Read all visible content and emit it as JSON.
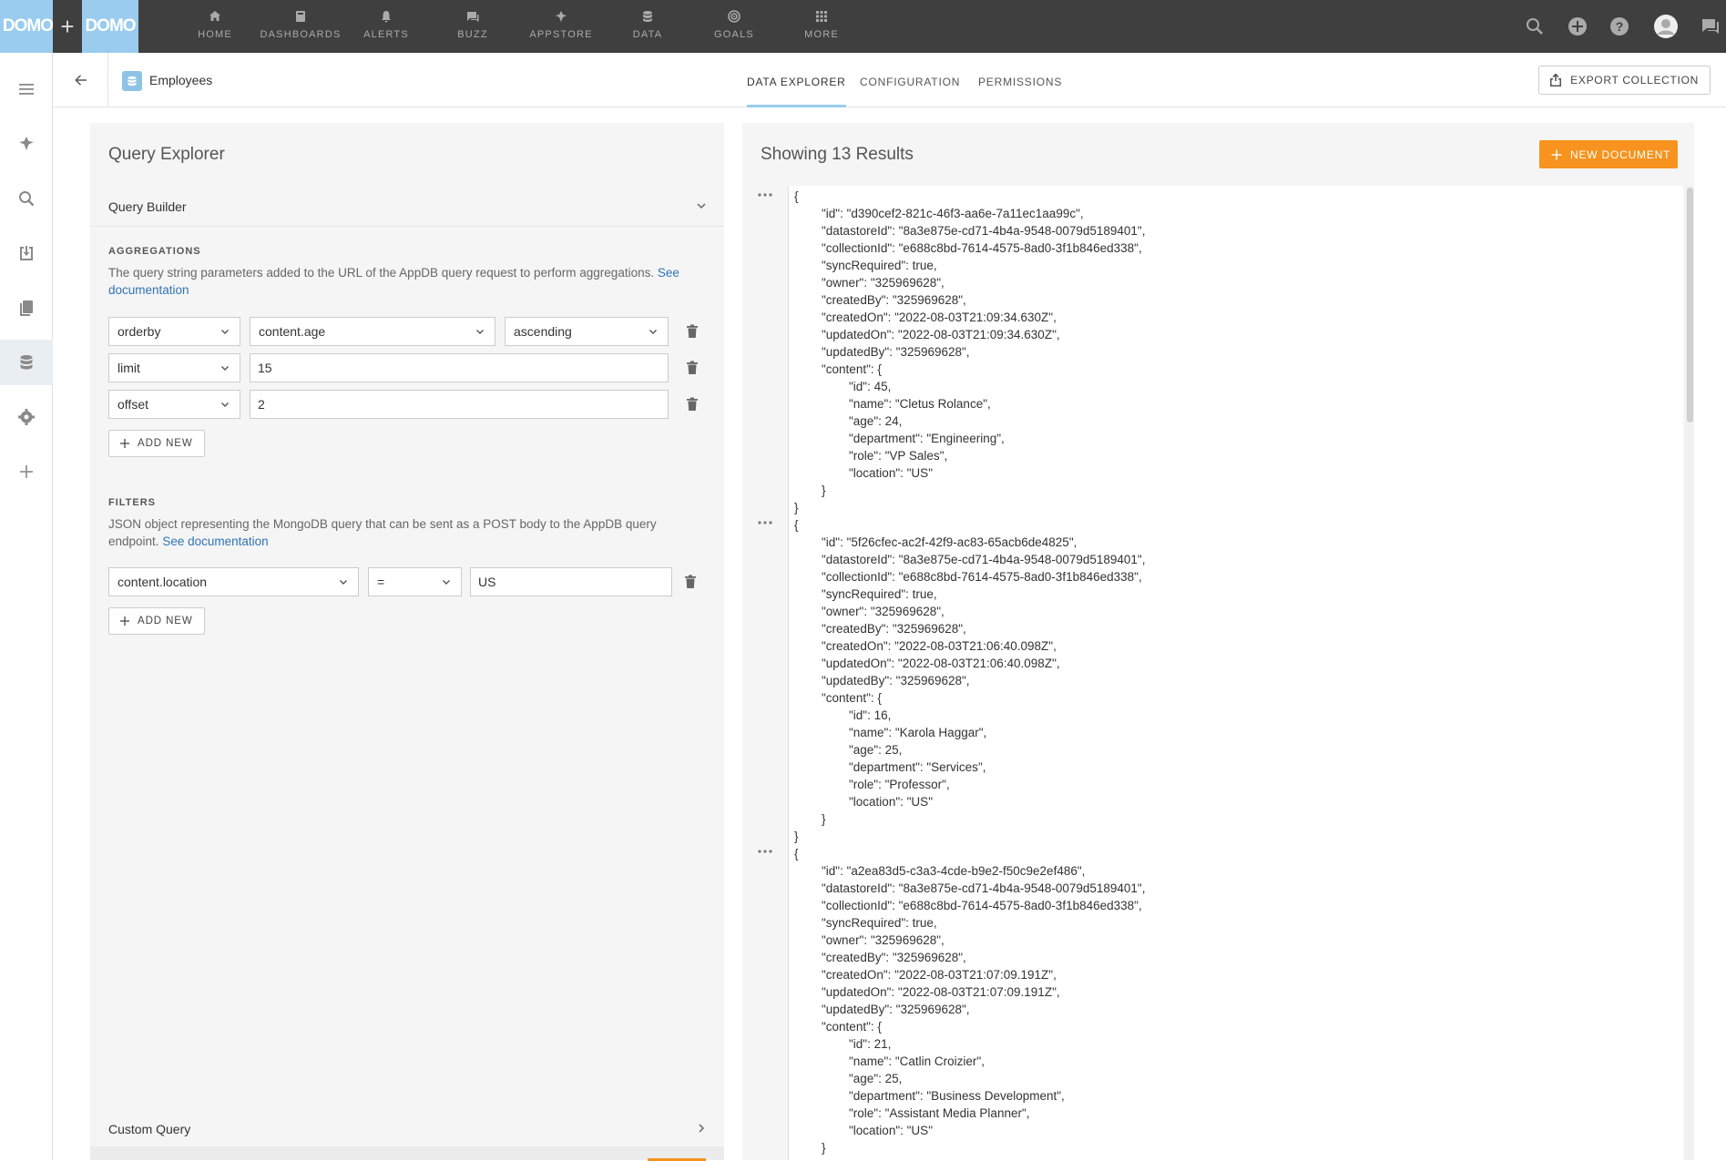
{
  "brand": {
    "logo_left": "DOMO",
    "logo_right": "DOMO",
    "plus": "+"
  },
  "topnav": [
    {
      "label": "HOME",
      "icon": "home-icon"
    },
    {
      "label": "DASHBOARDS",
      "icon": "dashboards-icon"
    },
    {
      "label": "ALERTS",
      "icon": "bell-icon"
    },
    {
      "label": "BUZZ",
      "icon": "chat-icon"
    },
    {
      "label": "APPSTORE",
      "icon": "appstore-icon"
    },
    {
      "label": "DATA",
      "icon": "database-icon"
    },
    {
      "label": "GOALS",
      "icon": "goals-icon"
    },
    {
      "label": "MORE",
      "icon": "grid-icon"
    }
  ],
  "header": {
    "collection_name": "Employees",
    "tabs": [
      "DATA EXPLORER",
      "CONFIGURATION",
      "PERMISSIONS"
    ],
    "active_tab": "DATA EXPLORER",
    "export_label": "EXPORT COLLECTION"
  },
  "query_explorer": {
    "title": "Query Explorer",
    "builder_title": "Query Builder",
    "aggregations": {
      "label": "AGGREGATIONS",
      "desc": "The query string parameters added to the URL of the AppDB query request to perform aggregations.",
      "link": "See documentation",
      "rows": [
        {
          "param": "orderby",
          "value": "content.age",
          "order": "ascending"
        },
        {
          "param": "limit",
          "value": "15"
        },
        {
          "param": "offset",
          "value": "2"
        }
      ],
      "add_label": "ADD NEW"
    },
    "filters": {
      "label": "FILTERS",
      "desc": "JSON object representing the MongoDB query that can be sent as a POST body to the AppDB query endpoint.",
      "link": "See documentation",
      "rows": [
        {
          "field": "content.location",
          "op": "=",
          "value": "US"
        }
      ],
      "add_label": "ADD NEW"
    },
    "custom_query_title": "Custom Query"
  },
  "results": {
    "title": "Showing 13 Results",
    "new_doc_label": "NEW DOCUMENT",
    "docs": [
      {
        "id": "d390cef2-821c-46f3-aa6e-7a11ec1aa99c",
        "datastoreId": "8a3e875e-cd71-4b4a-9548-0079d5189401",
        "collectionId": "e688c8bd-7614-4575-8ad0-3f1b846ed338",
        "syncRequired": "true",
        "owner": "325969628",
        "createdBy": "325969628",
        "createdOn": "2022-08-03T21:09:34.630Z",
        "updatedOn": "2022-08-03T21:09:34.630Z",
        "updatedBy": "325969628",
        "content": {
          "id": "45",
          "name": "Cletus Rolance",
          "age": "24",
          "department": "Engineering",
          "role": "VP Sales",
          "location": "US"
        }
      },
      {
        "id": "5f26cfec-ac2f-42f9-ac83-65acb6de4825",
        "datastoreId": "8a3e875e-cd71-4b4a-9548-0079d5189401",
        "collectionId": "e688c8bd-7614-4575-8ad0-3f1b846ed338",
        "syncRequired": "true",
        "owner": "325969628",
        "createdBy": "325969628",
        "createdOn": "2022-08-03T21:06:40.098Z",
        "updatedOn": "2022-08-03T21:06:40.098Z",
        "updatedBy": "325969628",
        "content": {
          "id": "16",
          "name": "Karola Haggar",
          "age": "25",
          "department": "Services",
          "role": "Professor",
          "location": "US"
        }
      },
      {
        "id": "a2ea83d5-c3a3-4cde-b9e2-f50c9e2ef486",
        "datastoreId": "8a3e875e-cd71-4b4a-9548-0079d5189401",
        "collectionId": "e688c8bd-7614-4575-8ad0-3f1b846ed338",
        "syncRequired": "true",
        "owner": "325969628",
        "createdBy": "325969628",
        "createdOn": "2022-08-03T21:07:09.191Z",
        "updatedOn": "2022-08-03T21:07:09.191Z",
        "updatedBy": "325969628",
        "content": {
          "id": "21",
          "name": "Catlin Croizier",
          "age": "25",
          "department": "Business Development",
          "role": "Assistant Media Planner",
          "location": "US"
        }
      }
    ]
  },
  "colors": {
    "accent": "#99ccee",
    "orange": "#f7931e",
    "topbar": "#3f3f3f",
    "link": "#2f74b5"
  }
}
